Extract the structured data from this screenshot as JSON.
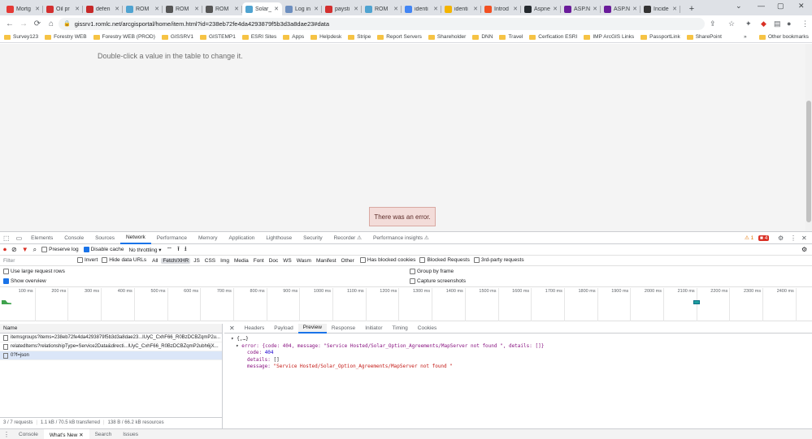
{
  "browser": {
    "tabs": [
      {
        "label": "Mortg",
        "color": "#e53935"
      },
      {
        "label": "Oil pr",
        "color": "#d32f2f"
      },
      {
        "label": "defen",
        "color": "#c62828"
      },
      {
        "label": "ROM",
        "color": "#4fa3d1"
      },
      {
        "label": "ROM",
        "color": "#555555"
      },
      {
        "label": "ROM",
        "color": "#555555"
      },
      {
        "label": "Solar_",
        "color": "#4fa3d1",
        "active": true
      },
      {
        "label": "Log in",
        "color": "#6c8ebf"
      },
      {
        "label": "paysti",
        "color": "#d32f2f"
      },
      {
        "label": "ROM",
        "color": "#4fa3d1"
      },
      {
        "label": "identi",
        "color": "#4285f4"
      },
      {
        "label": "identi",
        "color": "#f4b400"
      },
      {
        "label": "Introd",
        "color": "#f25022"
      },
      {
        "label": "Aspne",
        "color": "#24292e"
      },
      {
        "label": "ASP.N",
        "color": "#6a1b9a"
      },
      {
        "label": "ASP.N",
        "color": "#6a1b9a"
      },
      {
        "label": "Incide",
        "color": "#333333"
      }
    ],
    "url": "gissrv1.romlc.net/arcgisportal/home/item.html?id=238eb72fe4da4293879f5b3d3a8dae23#data",
    "bookmarks": [
      "Survey123",
      "Forestry WEB",
      "Forestry WEB (PROD)",
      "GISSRV1",
      "GISTEMP1",
      "ESRI Sites",
      "Apps",
      "Helpdesk",
      "Stripe",
      "Report Servers",
      "Shareholder",
      "DNN",
      "Travel",
      "Cerfication ESRI",
      "IMP ArcGIS Links",
      "PassportLink",
      "SharePoint"
    ],
    "other_bookmarks": "Other bookmarks",
    "overflow": "»"
  },
  "page": {
    "hint": "Double-click a value in the table to change it.",
    "error": "There was an error."
  },
  "devtools": {
    "tabs": [
      "Elements",
      "Console",
      "Sources",
      "Network",
      "Performance",
      "Memory",
      "Application",
      "Lighthouse",
      "Security",
      "Recorder ⚠",
      "Performance insights ⚠"
    ],
    "active_tab": "Network",
    "warnings": "1",
    "errors": "4",
    "controls": {
      "preserve_log": "Preserve log",
      "disable_cache": "Disable cache",
      "throttling": "No throttling"
    },
    "filter": {
      "placeholder": "Filter",
      "invert": "Invert",
      "hide_data_urls": "Hide data URLs",
      "types": [
        "All",
        "Fetch/XHR",
        "JS",
        "CSS",
        "Img",
        "Media",
        "Font",
        "Doc",
        "WS",
        "Wasm",
        "Manifest",
        "Other"
      ],
      "selected_type": "Fetch/XHR",
      "has_blocked_cookies": "Has blocked cookies",
      "blocked_requests": "Blocked Requests",
      "third_party": "3rd-party requests"
    },
    "options": {
      "large_rows": "Use large request rows",
      "group_by_frame": "Group by frame",
      "show_overview": "Show overview",
      "capture_screenshots": "Capture screenshots"
    },
    "timeline_ticks": [
      "100 ms",
      "200 ms",
      "300 ms",
      "400 ms",
      "500 ms",
      "600 ms",
      "700 ms",
      "800 ms",
      "900 ms",
      "1000 ms",
      "1100 ms",
      "1200 ms",
      "1300 ms",
      "1400 ms",
      "1500 ms",
      "1600 ms",
      "1700 ms",
      "1800 ms",
      "1900 ms",
      "2000 ms",
      "2100 ms",
      "2200 ms",
      "2300 ms",
      "2400 ms"
    ],
    "name_header": "Name",
    "requests": [
      "itemsgroups?items=238eb72fe4da4293879f5b3d3a8dae23...lUyC_CxhF66_R0BzDCBZqmP2u...",
      "relatedItems?relationshipType=Service2Data&directi...lUyC_CxhF66_R0BzDCBZqmP2ubh6jX...",
      "0?f=json"
    ],
    "selected_request": 2,
    "preview_tabs": [
      "Headers",
      "Payload",
      "Preview",
      "Response",
      "Initiator",
      "Timing",
      "Cookies"
    ],
    "active_preview_tab": "Preview",
    "json": {
      "root": "{,…}",
      "error_line": "error: {code: 404, message: \"Service Hosted/Solar_Option_Agreements/MapServer not found \", details: []}",
      "code_key": "code:",
      "code_val": "404",
      "details_key": "details:",
      "details_val": "[]",
      "message_key": "message:",
      "message_val": "\"Service Hosted/Solar_Option_Agreements/MapServer not found \""
    },
    "status": {
      "requests": "3 / 7 requests",
      "transferred": "1.1 kB / 70.5 kB transferred",
      "resources": "138 B / 66.2 kB resources"
    },
    "drawer_tabs": [
      "Console",
      "What's New ✕",
      "Search",
      "Issues"
    ],
    "active_drawer_tab": "What's New ✕"
  }
}
